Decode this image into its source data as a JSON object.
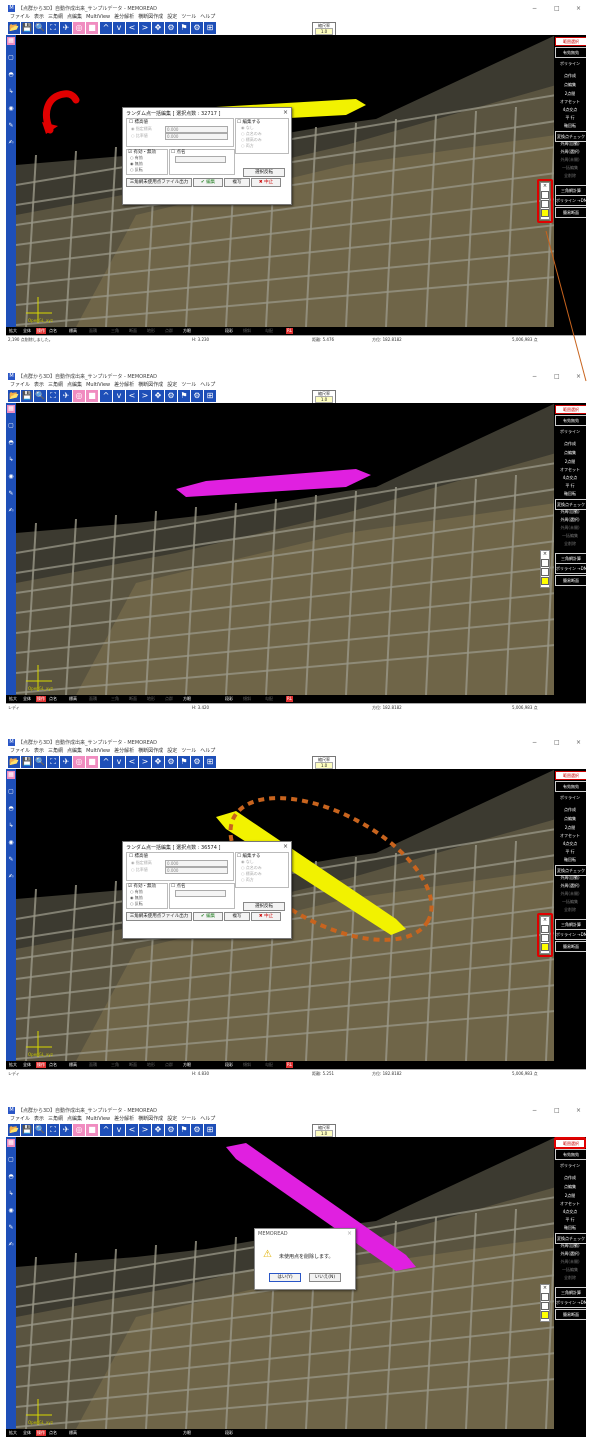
{
  "app": {
    "title": "【点群から3D】自動作成出来_サンプルデータ - MEMOREAD",
    "icon_label": "M",
    "window_controls": [
      "−",
      "□",
      "×"
    ],
    "menu": [
      "ファイル",
      "表示",
      "三角網",
      "点編集",
      "MultiView",
      "差分解析",
      "横断図作成",
      "設定",
      "ツール",
      "ヘルプ"
    ],
    "scale_label": "縮尺率",
    "scale_value": "1.0"
  },
  "right_panel": {
    "header": "範囲選択",
    "items": [
      "有効無効",
      "ポリライン",
      "点作成",
      "点編集",
      "2点間",
      "オフセット",
      "4点交点",
      "平 行",
      "軸回転",
      "変換点チェック",
      "外周(自動)",
      "外周(選択)",
      "外周(未開)",
      "一括編集",
      "全削除",
      "三角網計算",
      "ポリライン →DM変換",
      "簡易断面"
    ]
  },
  "bottom_bar": {
    "items": [
      "拡大",
      "全体",
      "操作",
      "点名",
      "標高",
      "面積",
      "三角",
      "断面",
      "地形",
      "点群",
      "方眼",
      "段彩",
      "傾斜",
      "勾配",
      "RL"
    ]
  },
  "axis_label": "OpenGL_xyz",
  "palette_close": "×",
  "panels": [
    {
      "status": [
        "2,190 点削除しました。",
        "H:  3.230",
        "距離:  5.476",
        "方位: 182.8182",
        "5,006,983 点"
      ],
      "has_red_arrow": true,
      "dialog": {
        "title": "ランダム点一括編集 [ 選択点数 : 32717 ]",
        "elev_check": "標高値",
        "radio_specified": "指定標高",
        "radio_ratio": "比率値",
        "value_specified": "0.000",
        "value_ratio": "0.000",
        "edit_check": "編集する",
        "radio_none": "なし",
        "radio_pointonly": "点名のみ",
        "radio_elevonly": "標高のみ",
        "radio_both": "両方",
        "valid_check": "有効・無効",
        "radio_valid": "有効",
        "radio_invalid": "無効",
        "radio_invert": "反転",
        "name_check": "点名",
        "select_invert": "選択反転",
        "export_button": "三角網未使用点ファイル出力",
        "edit_button": "✔ 編集",
        "copy_button": "複写",
        "cancel_button": "✖ 中止"
      }
    },
    {
      "status": [
        "レディ",
        "H:  3.420",
        "",
        "方位: 182.8182",
        "5,006,983 点"
      ]
    },
    {
      "status": [
        "レディ",
        "H:  4.830",
        "距離:  5.251",
        "方位: 182.8182",
        "5,006,983 点"
      ],
      "has_dashed_ellipse": true,
      "dialog": {
        "title": "ランダム点一括編集 [ 選択点数 : 36574 ]",
        "elev_check": "標高値",
        "radio_specified": "指定標高",
        "radio_ratio": "比率値",
        "value_specified": "0.000",
        "value_ratio": "0.000",
        "edit_check": "編集する",
        "radio_none": "なし",
        "radio_pointonly": "点名のみ",
        "radio_elevonly": "標高のみ",
        "radio_both": "両方",
        "valid_check": "有効・無効",
        "radio_valid": "有効",
        "radio_invalid": "無効",
        "radio_invert": "反転",
        "name_check": "点名",
        "select_invert": "選択反転",
        "export_button": "三角網未使用点ファイル出力",
        "edit_button": "✔ 編集",
        "copy_button": "複写",
        "cancel_button": "✖ 中止"
      }
    },
    {
      "status": [],
      "message_box": {
        "title": "MEMOREAD",
        "close": "×",
        "message": "未使用点を削除します。",
        "yes": "はい(Y)",
        "no": "いいえ(N)"
      }
    }
  ],
  "colors": {
    "toolbar_blue": "#1e4fb8",
    "accent_pink": "#f08cc0",
    "highlight_yellow": "#f2f200",
    "highlight_magenta": "#e020e0",
    "annotation_red": "#e00000",
    "annotation_orange": "#c8641e"
  }
}
